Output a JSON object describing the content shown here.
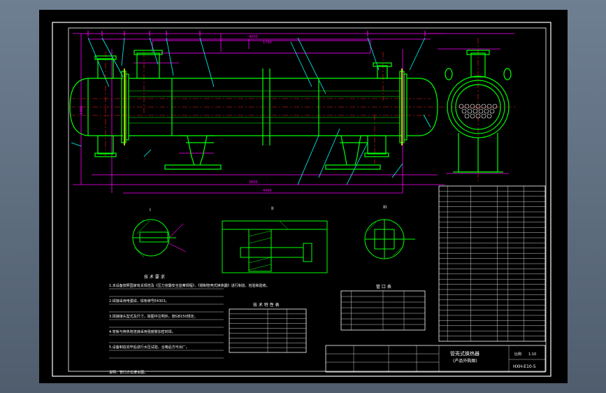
{
  "colors": {
    "background": "#000000",
    "frame": "#ffffff",
    "outline": "#00ff00",
    "dimension": "#ff00ff",
    "centerline": "#ff2020",
    "leader": "#00ffff",
    "highlight": "#ffff00"
  },
  "drawing": {
    "tech_requirements_title": "技 术 要 求",
    "tech_requirements": [
      "1.本设备按照国家有关规范及《压力容器安全监察规程》、《钢制管壳式换热器》进行制造、检验和验收。",
      "2.焊接采用电弧焊，焊条牌号E4303。",
      "3.焊接接头型式及尺寸，除图中注明外，按GB150规定。",
      "4.管板与换热管连接采用强度胀加密封焊。",
      "5.设备制造完毕后进行水压试验，合格后方可出厂。",
      "说明：管口方位按本图。"
    ],
    "tech_char_table_title": "技 术 特 性 表",
    "nozzle_table_title": "管 口 表",
    "drawing_title": "管壳式换热器",
    "drawing_subtitle": "(产品外购图)",
    "drawing_number": "HXH-E10-5",
    "scale_label": "比例",
    "scale_value": "1:10",
    "section_labels": [
      "I",
      "II",
      "III"
    ]
  }
}
